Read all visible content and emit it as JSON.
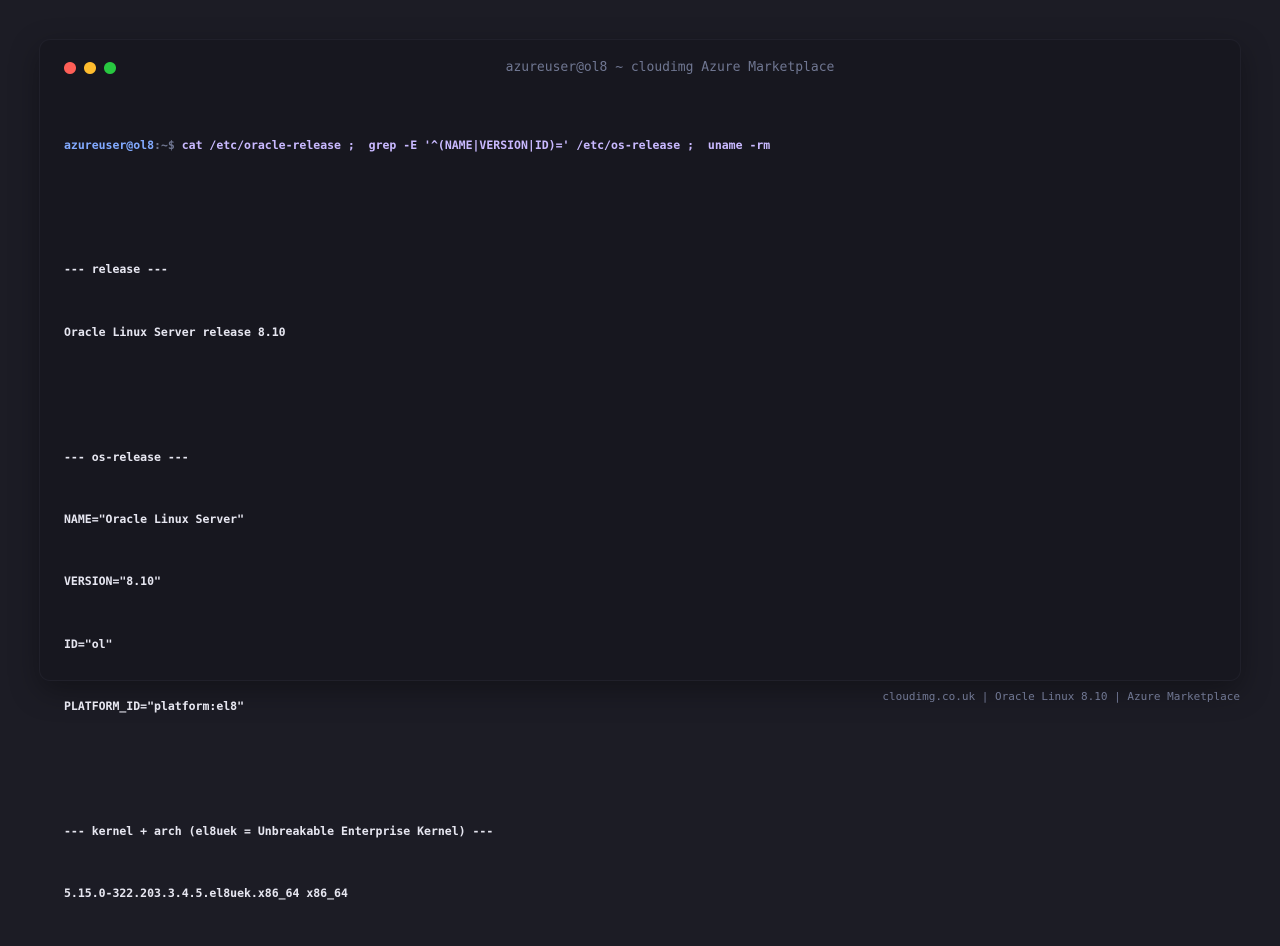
{
  "window": {
    "title": "azureuser@ol8 ~ cloudimg Azure Marketplace"
  },
  "terminal": {
    "prompt_user": "azureuser@ol8",
    "prompt_path": ":~$",
    "command": " cat /etc/oracle-release ;  grep -E '^(NAME|VERSION|ID)=' /etc/os-release ;  uname -rm",
    "release_header": "--- release ---",
    "release_line": "Oracle Linux Server release 8.10",
    "os_release_header": "--- os-release ---",
    "os_release_lines": [
      "NAME=\"Oracle Linux Server\"",
      "VERSION=\"8.10\"",
      "ID=\"ol\"",
      "PLATFORM_ID=\"platform:el8\""
    ],
    "kernel_header": "--- kernel + arch (el8uek = Unbreakable Enterprise Kernel) ---",
    "kernel_line": "5.15.0-322.203.3.4.5.el8uek.x86_64 x86_64"
  },
  "footer": {
    "text": "cloudimg.co.uk | Oracle Linux 8.10 | Azure Marketplace"
  },
  "colors": {
    "background": "#1c1c25",
    "window": "#17171f",
    "prompt": "#82aaff",
    "command": "#c9b9ff",
    "output": "#e6e6f0",
    "muted": "#6f7691",
    "close": "#fe5f57",
    "minimize": "#febc2e",
    "maximize": "#28c840"
  }
}
